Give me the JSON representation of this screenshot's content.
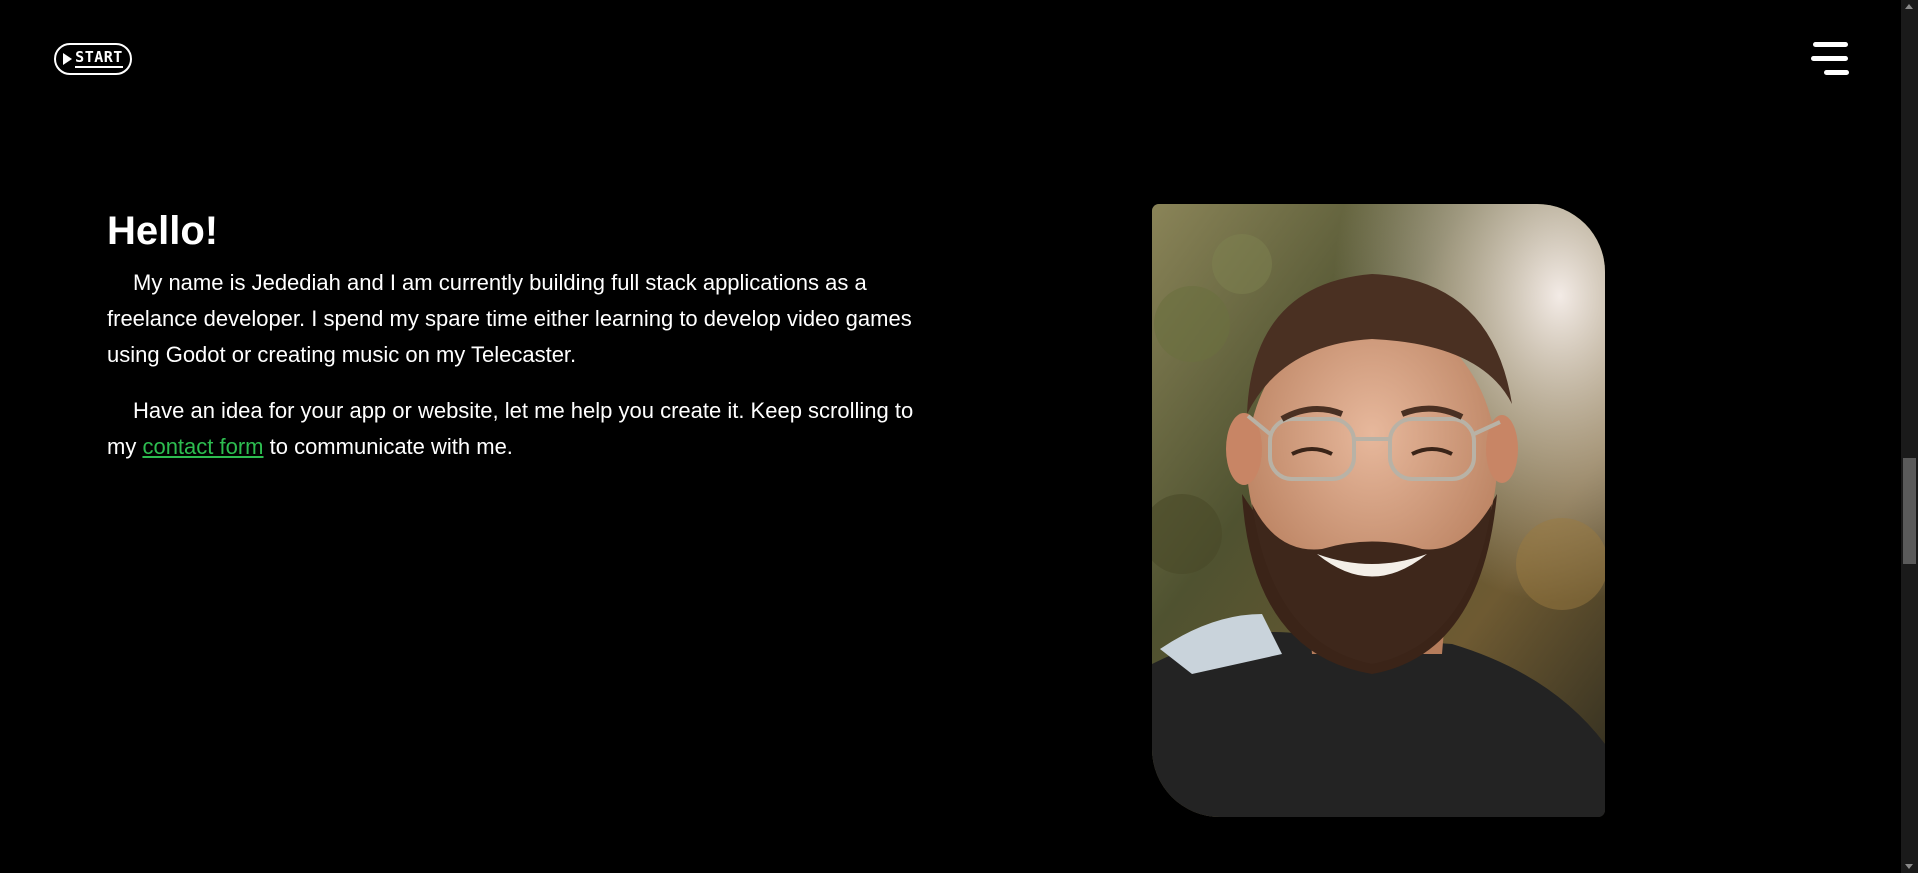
{
  "header": {
    "logo_text": "START",
    "menu_icon": "hamburger-menu-icon"
  },
  "intro": {
    "heading": "Hello!",
    "paragraph1": "My name is Jedediah and I am currently building full stack applications as a freelance developer. I spend my spare time either learning to develop video games using Godot or creating music on my Telecaster.",
    "paragraph2_before": "Have an idea for your app or website, let me help you create it. Keep scrolling to my ",
    "paragraph2_link": "contact form",
    "paragraph2_after": " to communicate with me."
  },
  "portrait": {
    "alt": "Portrait photo"
  },
  "colors": {
    "background": "#000000",
    "text": "#ffffff",
    "link": "#2dbd50"
  }
}
